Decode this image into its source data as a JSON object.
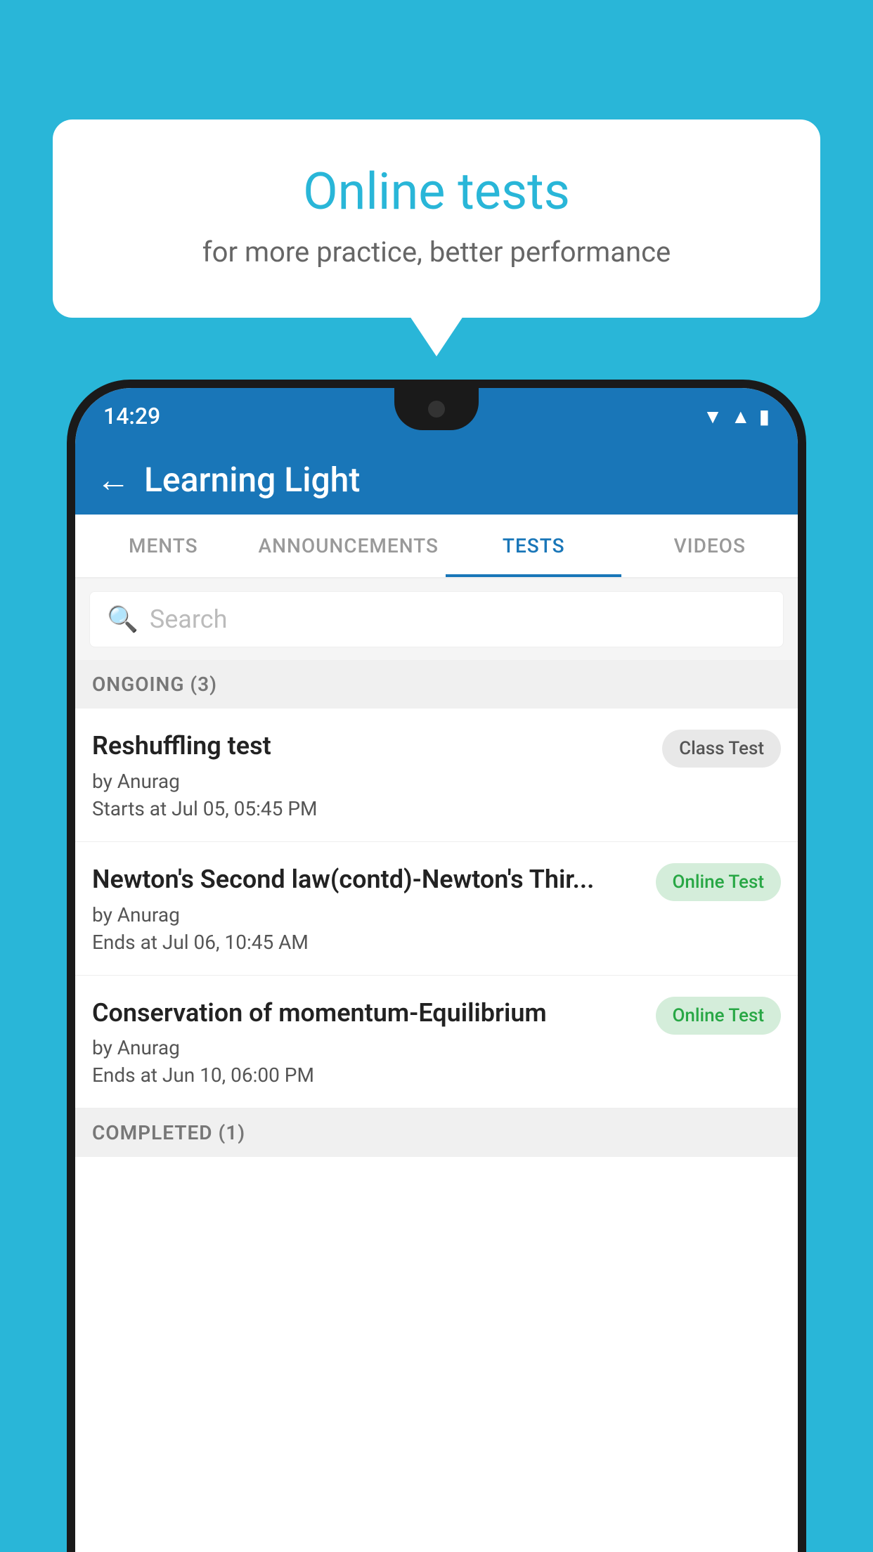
{
  "background_color": "#29b6d8",
  "speech_bubble": {
    "title": "Online tests",
    "subtitle": "for more practice, better performance"
  },
  "phone": {
    "status_bar": {
      "time": "14:29",
      "icons": [
        "wifi",
        "signal",
        "battery"
      ]
    },
    "app_header": {
      "back_label": "←",
      "title": "Learning Light"
    },
    "tabs": [
      {
        "label": "MENTS",
        "active": false
      },
      {
        "label": "ANNOUNCEMENTS",
        "active": false
      },
      {
        "label": "TESTS",
        "active": true
      },
      {
        "label": "VIDEOS",
        "active": false
      }
    ],
    "search": {
      "placeholder": "Search"
    },
    "ongoing_section": {
      "header": "ONGOING (3)",
      "items": [
        {
          "name": "Reshuffling test",
          "author": "by Anurag",
          "date": "Starts at  Jul 05, 05:45 PM",
          "badge": "Class Test",
          "badge_type": "class"
        },
        {
          "name": "Newton's Second law(contd)-Newton's Thir...",
          "author": "by Anurag",
          "date": "Ends at  Jul 06, 10:45 AM",
          "badge": "Online Test",
          "badge_type": "online"
        },
        {
          "name": "Conservation of momentum-Equilibrium",
          "author": "by Anurag",
          "date": "Ends at  Jun 10, 06:00 PM",
          "badge": "Online Test",
          "badge_type": "online"
        }
      ]
    },
    "completed_section": {
      "header": "COMPLETED (1)"
    }
  }
}
